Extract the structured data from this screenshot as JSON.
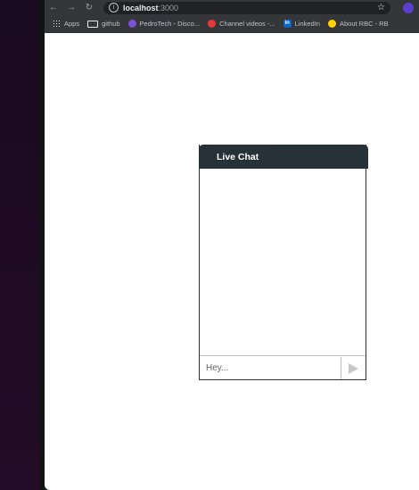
{
  "browser": {
    "url_host": "localhost",
    "url_port": ":3000",
    "nav": {
      "back": "←",
      "forward": "→",
      "reload": "↻"
    },
    "info_icon": "i",
    "star_icon": "☆",
    "bookmarks": [
      {
        "label": "Apps",
        "icon": "apps-grid-icon"
      },
      {
        "label": "github",
        "icon": "folder-icon"
      },
      {
        "label": "PedroTech - Disco...",
        "icon": "pedrotech-icon"
      },
      {
        "label": "Channel videos -...",
        "icon": "youtube-icon"
      },
      {
        "label": "LinkedIn",
        "icon": "linkedin-icon",
        "glyph": "in"
      },
      {
        "label": "About RBC - RB",
        "icon": "rbc-icon"
      }
    ]
  },
  "chat": {
    "title": "Live Chat",
    "input_placeholder": "Hey...",
    "send_icon": "send-arrow-icon",
    "header_color": "#263238"
  }
}
